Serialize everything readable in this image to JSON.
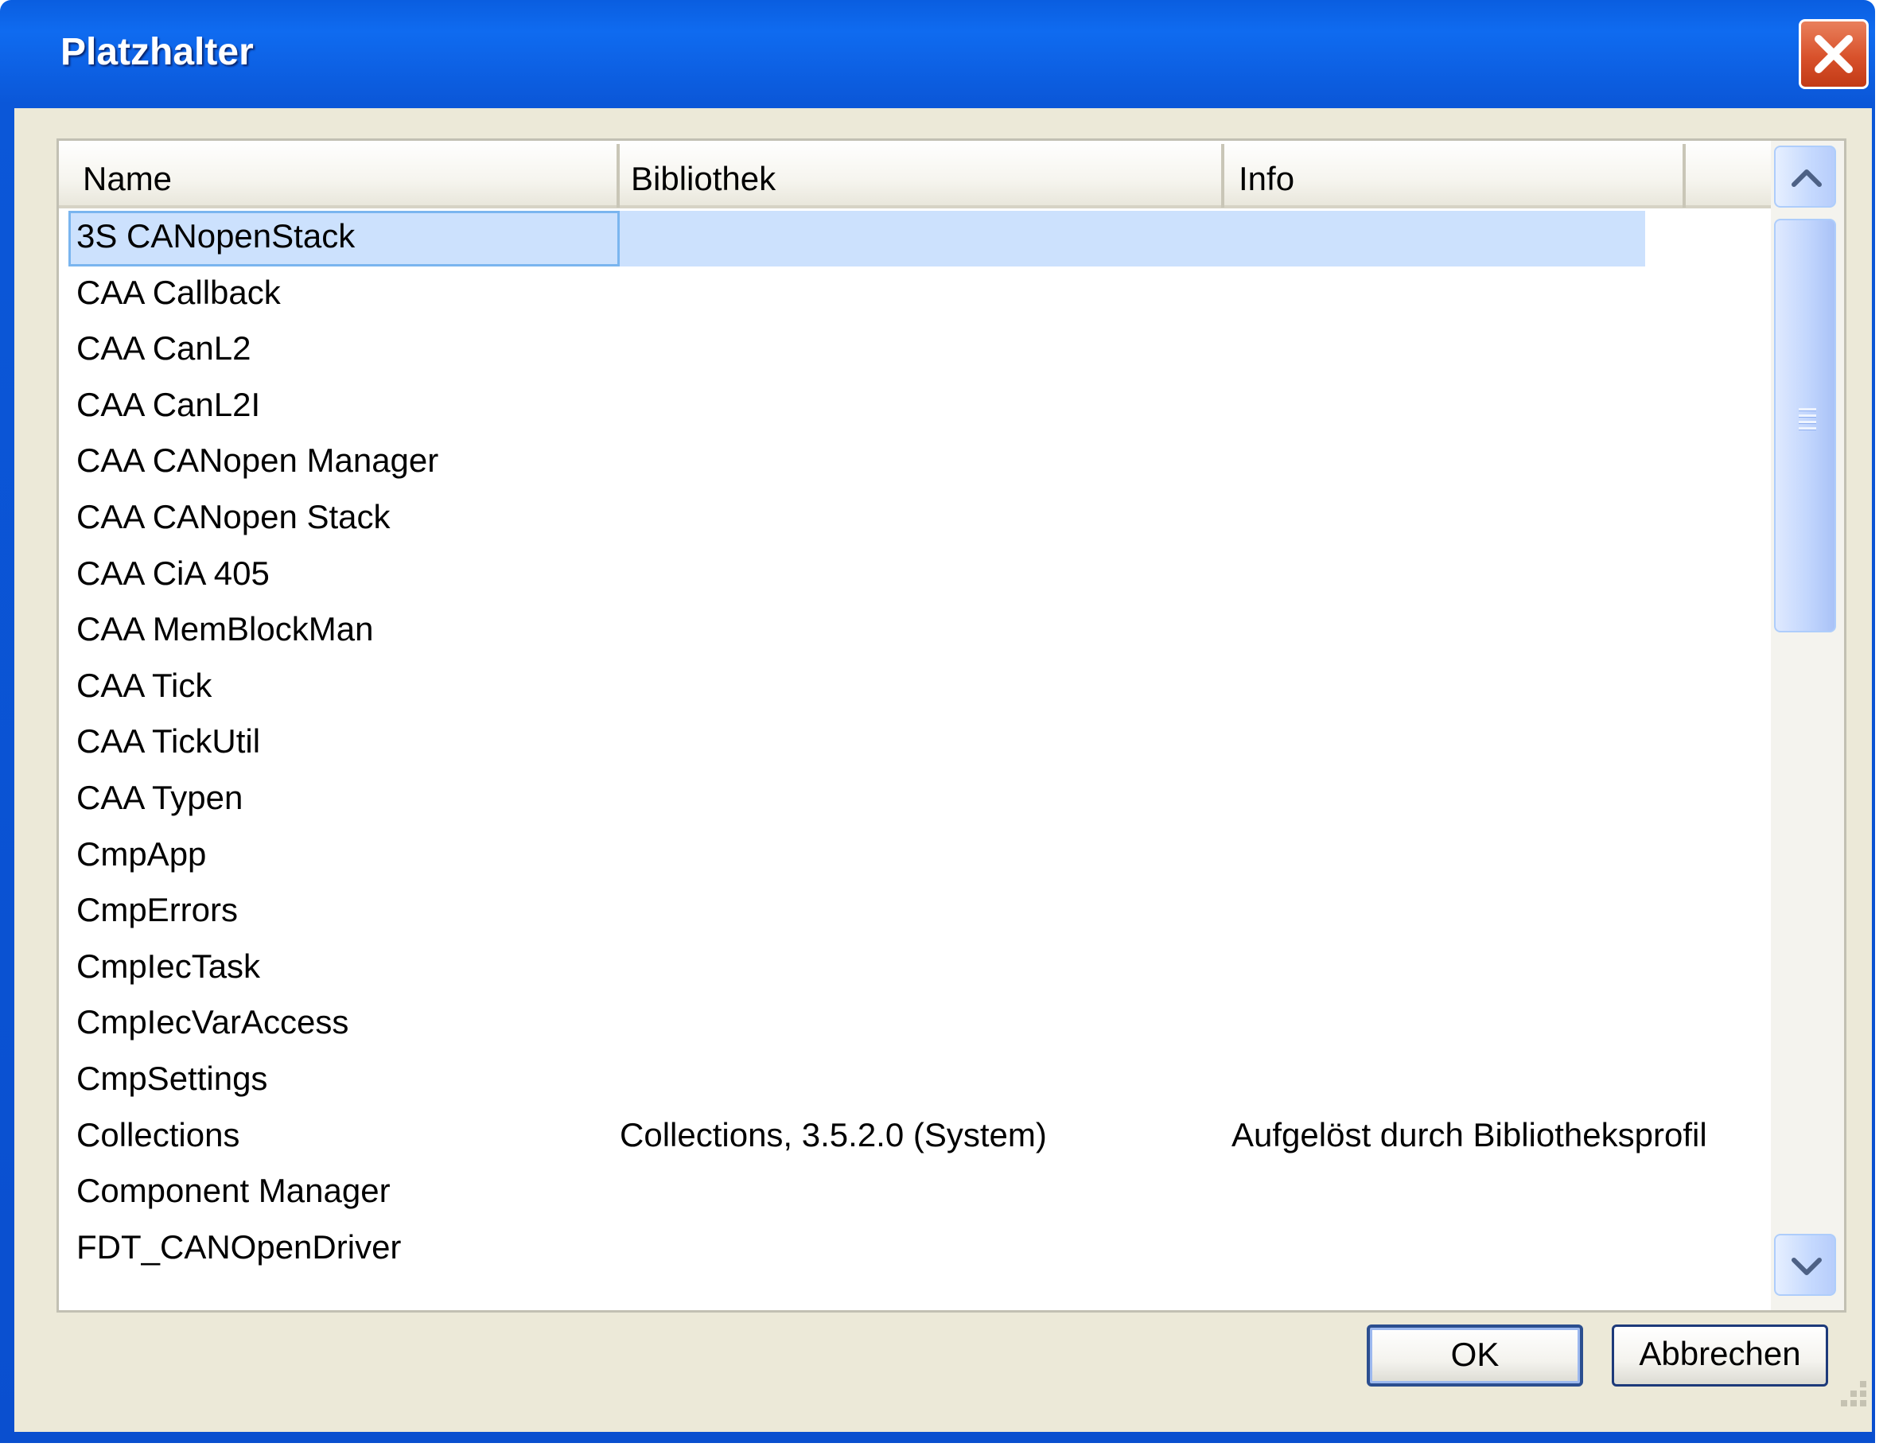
{
  "window": {
    "title": "Platzhalter"
  },
  "columns": {
    "name": "Name",
    "library": "Bibliothek",
    "info": "Info"
  },
  "rows": [
    {
      "name": "3S CANopenStack",
      "library": "",
      "info": ""
    },
    {
      "name": "CAA Callback",
      "library": "",
      "info": ""
    },
    {
      "name": "CAA CanL2",
      "library": "",
      "info": ""
    },
    {
      "name": "CAA CanL2I",
      "library": "",
      "info": ""
    },
    {
      "name": "CAA CANopen Manager",
      "library": "",
      "info": ""
    },
    {
      "name": "CAA CANopen Stack",
      "library": "",
      "info": ""
    },
    {
      "name": "CAA CiA 405",
      "library": "",
      "info": ""
    },
    {
      "name": "CAA MemBlockMan",
      "library": "",
      "info": ""
    },
    {
      "name": "CAA Tick",
      "library": "",
      "info": ""
    },
    {
      "name": "CAA TickUtil",
      "library": "",
      "info": ""
    },
    {
      "name": "CAA Typen",
      "library": "",
      "info": ""
    },
    {
      "name": "CmpApp",
      "library": "",
      "info": ""
    },
    {
      "name": "CmpErrors",
      "library": "",
      "info": ""
    },
    {
      "name": "CmpIecTask",
      "library": "",
      "info": ""
    },
    {
      "name": "CmpIecVarAccess",
      "library": "",
      "info": ""
    },
    {
      "name": "CmpSettings",
      "library": "",
      "info": ""
    },
    {
      "name": "Collections",
      "library": "Collections, 3.5.2.0 (System)",
      "info": "Aufgelöst durch Bibliotheksprofil"
    },
    {
      "name": "Component Manager",
      "library": "",
      "info": ""
    },
    {
      "name": "FDT_CANOpenDriver",
      "library": "",
      "info": ""
    }
  ],
  "selected_row": 0,
  "buttons": {
    "ok": "OK",
    "cancel": "Abbrechen"
  },
  "icons": {
    "close": "close-icon",
    "scroll_up": "chevron-up-icon",
    "scroll_down": "chevron-down-icon",
    "resize": "resize-grip-icon"
  },
  "colors": {
    "titlebar": "#0a5ee0",
    "selection": "#cce1fd",
    "close_button": "#d8512b",
    "dialog_background": "#ece9d8"
  }
}
